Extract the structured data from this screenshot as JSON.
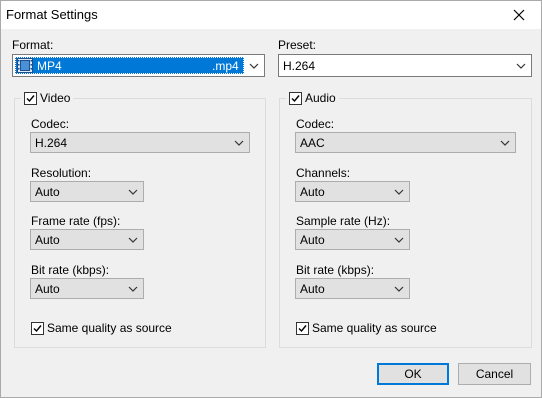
{
  "window": {
    "title": "Format Settings"
  },
  "format": {
    "label": "Format:",
    "value": "MP4",
    "extension": ".mp4",
    "icon": "film-icon",
    "highlight_color": "#0078d7"
  },
  "preset": {
    "label": "Preset:",
    "value": "H.264"
  },
  "video": {
    "title": "Video",
    "enabled": true,
    "codec": {
      "label": "Codec:",
      "value": "H.264"
    },
    "resolution": {
      "label": "Resolution:",
      "value": "Auto"
    },
    "frame_rate": {
      "label": "Frame rate (fps):",
      "value": "Auto"
    },
    "bit_rate": {
      "label": "Bit rate (kbps):",
      "value": "Auto"
    },
    "same_quality": {
      "label": "Same quality as source",
      "checked": true
    }
  },
  "audio": {
    "title": "Audio",
    "enabled": true,
    "codec": {
      "label": "Codec:",
      "value": "AAC"
    },
    "channels": {
      "label": "Channels:",
      "value": "Auto"
    },
    "sample_rate": {
      "label": "Sample rate (Hz):",
      "value": "Auto"
    },
    "bit_rate": {
      "label": "Bit rate (kbps):",
      "value": "Auto"
    },
    "same_quality": {
      "label": "Same quality as source",
      "checked": true
    }
  },
  "buttons": {
    "ok": "OK",
    "cancel": "Cancel"
  }
}
